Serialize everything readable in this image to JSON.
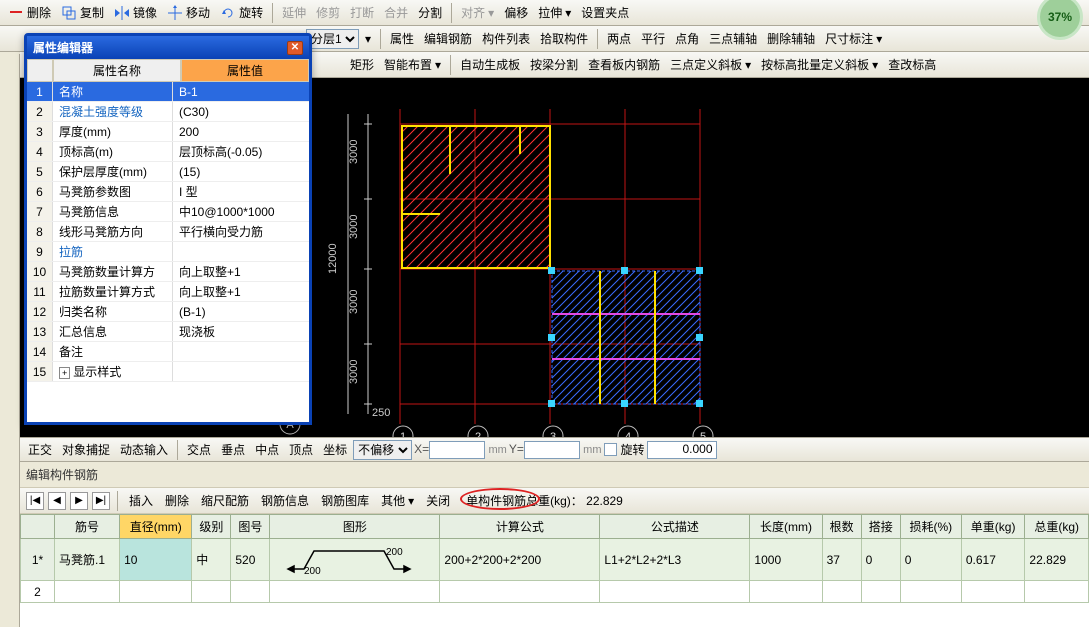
{
  "badge": "37%",
  "toolbar1": {
    "delete": "删除",
    "copy": "复制",
    "mirror": "镜像",
    "move": "移动",
    "rotate": "旋转",
    "extend": "延伸",
    "trim": "修剪",
    "break": "打断",
    "merge": "合并",
    "split": "分割",
    "align": "对齐",
    "offset": "偏移",
    "stretch": "拉伸",
    "setpin": "设置夹点"
  },
  "toolbar2": {
    "layer": "分层1",
    "attr": "属性",
    "editbar": "编辑钢筋",
    "complist": "构件列表",
    "pick": "拾取构件",
    "twopt": "两点",
    "parallel": "平行",
    "corner": "点角",
    "threept": "三点辅轴",
    "delaux": "删除辅轴",
    "dimension": "尺寸标注"
  },
  "toolbar3": {
    "rect": "矩形",
    "smart": "智能布置",
    "autogen": "自动生成板",
    "beamsplit": "按梁分割",
    "lookin": "查看板内钢筋",
    "tiltboard": "三点定义斜板",
    "batchtilt": "按标高批量定义斜板",
    "viewchg": "查改标高"
  },
  "propwin": {
    "title": "属性编辑器",
    "head_n": "属性名称",
    "head_v": "属性值",
    "rows": [
      {
        "n": "名称",
        "v": "B-1",
        "sel": true
      },
      {
        "n": "混凝土强度等级",
        "v": "(C30)",
        "link": true
      },
      {
        "n": "厚度(mm)",
        "v": "200"
      },
      {
        "n": "顶标高(m)",
        "v": "层顶标高(-0.05)"
      },
      {
        "n": "保护层厚度(mm)",
        "v": "(15)"
      },
      {
        "n": "马凳筋参数图",
        "v": "I 型"
      },
      {
        "n": "马凳筋信息",
        "v": "中10@1000*1000"
      },
      {
        "n": "线形马凳筋方向",
        "v": "平行横向受力筋"
      },
      {
        "n": "拉筋",
        "v": "",
        "link": true
      },
      {
        "n": "马凳筋数量计算方",
        "v": "向上取整+1"
      },
      {
        "n": "拉筋数量计算方式",
        "v": "向上取整+1"
      },
      {
        "n": "归类名称",
        "v": "(B-1)"
      },
      {
        "n": "汇总信息",
        "v": "现浇板"
      },
      {
        "n": "备注",
        "v": ""
      },
      {
        "n": "显示样式",
        "v": "",
        "exp": true
      }
    ]
  },
  "snap": {
    "ortho": "正交",
    "osnap": "对象捕捉",
    "dyn": "动态输入",
    "inter": "交点",
    "perp": "垂点",
    "mid": "中点",
    "peak": "顶点",
    "coord": "坐标",
    "off": "不偏移",
    "rot": "旋转",
    "x": "X=",
    "y": "Y=",
    "mm": "mm",
    "rotval": "0.000",
    "offval": "0"
  },
  "editor": {
    "title": "编辑构件钢筋",
    "insert": "插入",
    "delete": "删除",
    "scale": "缩尺配筋",
    "info": "钢筋信息",
    "lib": "钢筋图库",
    "other": "其他",
    "close": "关闭",
    "totallabel": "单构件钢筋总重(kg)：",
    "totalval": "22.829",
    "headers": {
      "no": "筋号",
      "dia": "直径(mm)",
      "lvl": "级别",
      "shape": "图号",
      "draw": "图形",
      "formula": "计算公式",
      "descr": "公式描述",
      "len": "长度(mm)",
      "qty": "根数",
      "lap": "搭接",
      "loss": "损耗(%)",
      "uw": "单重(kg)",
      "tw": "总重(kg)"
    },
    "rows": [
      {
        "rn": "1*",
        "no": "马凳筋.1",
        "dia": "10",
        "lvl": "中",
        "shape": "520",
        "formula": "200+2*200+2*200",
        "descr": "L1+2*L2+2*L3",
        "len": "1000",
        "qty": "37",
        "lap": "0",
        "loss": "0",
        "uw": "0.617",
        "tw": "22.829",
        "drawd1": "200",
        "drawd2": "200"
      },
      {
        "rn": "2"
      }
    ]
  },
  "axis": {
    "a": "A",
    "n1": "1",
    "n2": "2",
    "n3": "3",
    "n4": "4",
    "n5": "5",
    "d3000": "3000",
    "d250": "250",
    "d12000": "12000"
  }
}
